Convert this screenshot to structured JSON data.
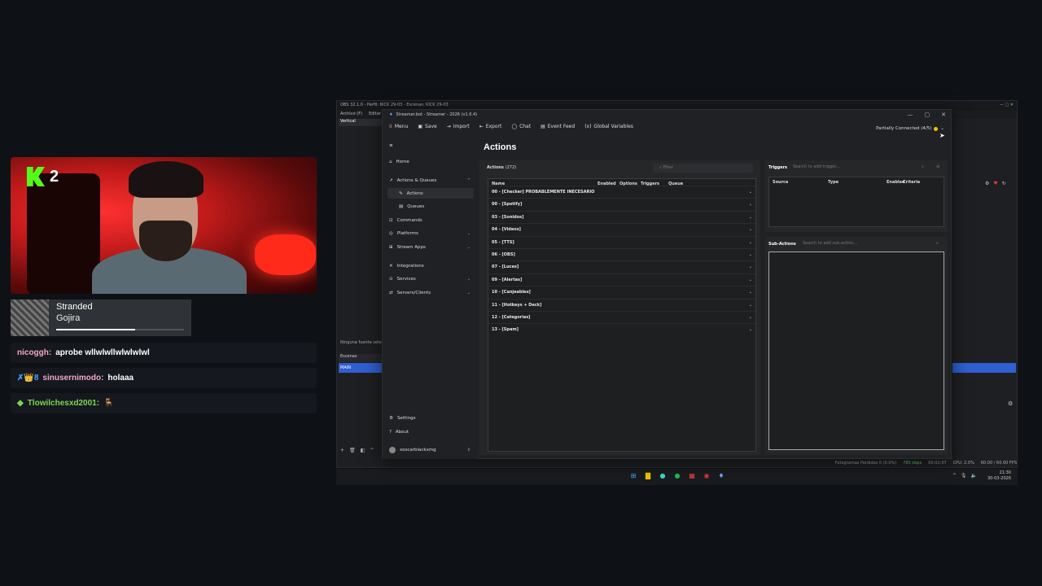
{
  "overlay": {
    "viewer_count": "2",
    "now_playing": {
      "title": "Stranded",
      "artist": "Gojira",
      "progress": 0.62
    },
    "chat": [
      {
        "user": "nicoggh:",
        "message": "aprobe wllwlwllwlwlwlwl",
        "color": "#f4a7c4",
        "badges": ""
      },
      {
        "user": "sinusernimodo:",
        "message": "holaaa",
        "color": "#f4a7c4",
        "badges": "✗👑8"
      },
      {
        "user": "Tlowilchesxd2001:",
        "message": "🪑",
        "color": "#7cd84f",
        "badges": "◆"
      }
    ]
  },
  "obs": {
    "title": "OBS 32.1.0 - Perfil: KICK 29-03 - Escenas: KICK 29-03",
    "menu": [
      "Archivo (F)",
      "Editar"
    ],
    "preview_label": "Vertical",
    "no_source": "Ninguna fuente selec",
    "scenes_label": "Escenas",
    "scene_main": "MAIN",
    "status_bar": [
      "Fotogramas Perdidos 0 (0.0%)",
      "785 kbps",
      "00:02:07",
      "CPU: 2.0%",
      "60.00 / 60.00 FPS"
    ],
    "clock": {
      "time": "21:30",
      "date": "30-03-2026"
    }
  },
  "streamerbot": {
    "title": "Streamer.bot - Streamer - 2026 (v1.0.4)",
    "toolbar": {
      "menu": "Menu",
      "save": "Save",
      "import": "Import",
      "export": "Export",
      "chat": "Chat",
      "event_feed": "Event Feed",
      "global_vars": "Global Variables"
    },
    "status": "Partially Connected (4/5)",
    "sidebar": {
      "home": "Home",
      "actions_queues": "Actions & Queues",
      "actions": "Actions",
      "queues": "Queues",
      "commands": "Commands",
      "platforms": "Platforms",
      "stream_apps": "Stream Apps",
      "integrations": "Integrations",
      "services": "Services",
      "servers_clients": "Servers/Clients",
      "settings": "Settings",
      "about": "About",
      "user": "xoscarblackxmg"
    },
    "page_title": "Actions",
    "actions_label": "Actions",
    "actions_count": "(272)",
    "filter_placeholder": "Filter",
    "columns": {
      "name": "Name",
      "enabled": "Enabled",
      "options": "Options",
      "triggers": "Triggers",
      "queue": "Queue"
    },
    "groups": [
      "00 - [Checker] PROBABLEMENTE INECESARIO",
      "00 - [Spotify]",
      "03 - [Sonidos]",
      "04 - [Videos]",
      "05 - [TTS]",
      "06 - [OBS]",
      "07 - [Luces]",
      "09 - [Alertas]",
      "10 - [Canjeables]",
      "11 - [Hotkeys + Deck]",
      "12 - [Categorias]",
      "13 - [Spam]"
    ],
    "triggers": {
      "title": "Triggers",
      "search_placeholder": "Search to add trigger...",
      "columns": {
        "source": "Source",
        "type": "Type",
        "enabled": "Enabled",
        "criteria": "Criteria"
      }
    },
    "sub_actions": {
      "title": "Sub-Actions",
      "search_placeholder": "Search to add sub-action..."
    }
  }
}
